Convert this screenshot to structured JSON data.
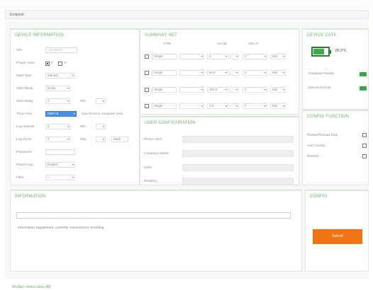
{
  "titlebar": {
    "text": ""
  },
  "toolbar": {
    "title": "Endpoint"
  },
  "device_info": {
    "title": "DEVICE INFORMATION",
    "rows": [
      {
        "label": "S/N",
        "value": "12345678"
      },
      {
        "label": "Power Save",
        "opt1": "F",
        "opt2": "N"
      },
      {
        "label": "Start Type",
        "value": "Manual"
      },
      {
        "label": "Start Mode",
        "value": "Delay"
      },
      {
        "label": "Start Delay",
        "value": "0",
        "unit": "Min"
      },
      {
        "label": "Time zone",
        "value": "GMT+8",
        "note": "Synchronize computer time"
      },
      {
        "label": "Log Interval",
        "value": "0",
        "unit": "Min"
      },
      {
        "label": "Log Cycle",
        "value": "0",
        "unit": "Day",
        "extra": "Mark"
      },
      {
        "label": "Password",
        "value": ""
      },
      {
        "label": "Report Lan",
        "value": "English"
      },
      {
        "label": "Filter",
        "value": "--"
      }
    ]
  },
  "summary": {
    "title": "SUMMARY SET",
    "headers": {
      "type": "TYPE",
      "value": "VALUE",
      "delay": "DELAY"
    },
    "rows": [
      {
        "type": "Single",
        "value": "0",
        "delay": "0",
        "delay_unit": "Min"
      },
      {
        "type": "Single",
        "value": "80.0",
        "delay": "0",
        "delay_unit": "Min"
      },
      {
        "type": "Single",
        "value": "100.0",
        "delay": "0",
        "delay_unit": "Min"
      },
      {
        "type": "Single",
        "value": "3.0",
        "delay": "0",
        "delay_unit": "Min"
      }
    ]
  },
  "user_config": {
    "title": "USER CONFIGURATION",
    "fields": [
      {
        "label": "Phone Num"
      },
      {
        "label": "Company Name"
      },
      {
        "label": "Units"
      },
      {
        "label": "Reading"
      }
    ]
  },
  "device_data": {
    "title": "DEVICE DATA",
    "battery": "28.3°C",
    "battery_level": 0.7,
    "rows": [
      {
        "label": "Hardware Ready"
      },
      {
        "label": "Device Normal"
      }
    ]
  },
  "config_function": {
    "title": "CONFIG FUNCTION",
    "rows": [
      {
        "label": "Restart/Reload Stop"
      },
      {
        "label": "Auto Config"
      },
      {
        "label": "Restore"
      }
    ]
  },
  "information": {
    "title": "INFORMATION",
    "message": "Information supplement, currently connected to recording."
  },
  "config_panel": {
    "title": "CONFIG",
    "button": "Submit"
  },
  "footer": {
    "link": "Modbus device data (All)"
  },
  "colors": {
    "accent": "#6ab46a",
    "orange": "#f07415",
    "green": "#3aa64a"
  }
}
